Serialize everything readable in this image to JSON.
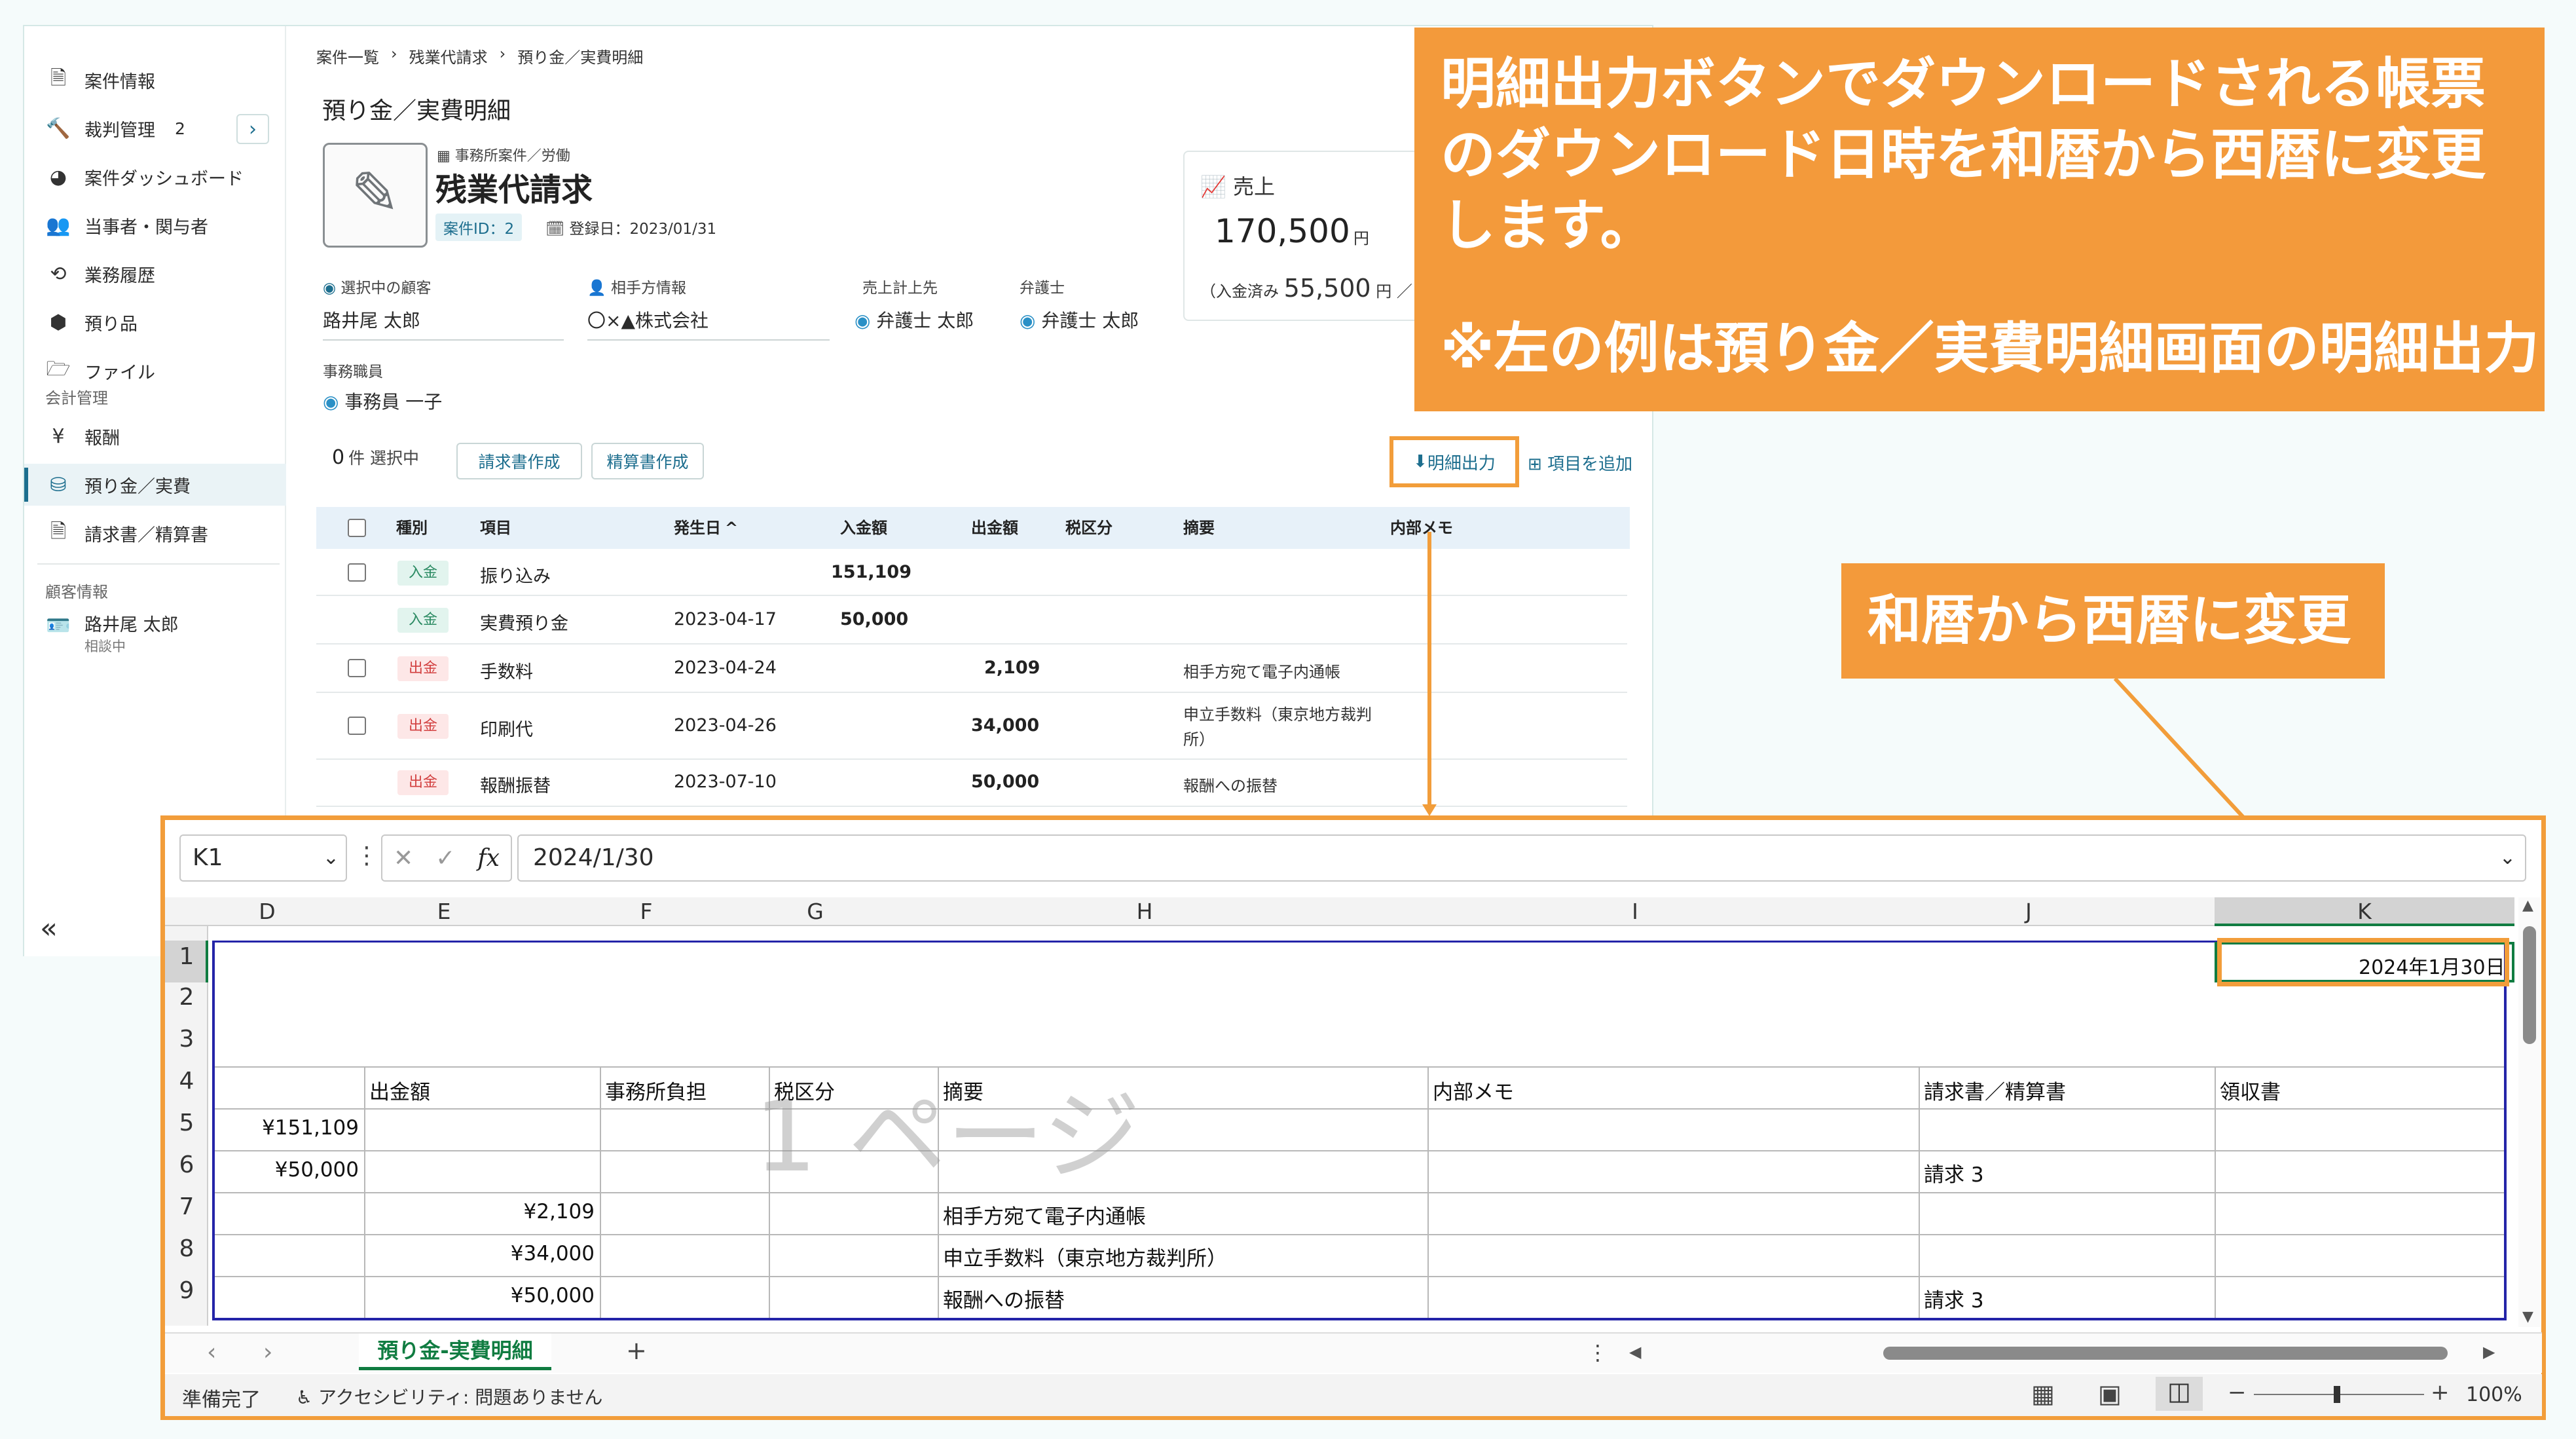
{
  "sidebar": {
    "items": [
      {
        "icon": "document-icon",
        "glyph": "🗎",
        "label": "案件情報"
      },
      {
        "icon": "gavel-icon",
        "glyph": "🔨",
        "label": "裁判管理",
        "count": "2"
      },
      {
        "icon": "dashboard-icon",
        "glyph": "◕",
        "label": "案件ダッシュボード"
      },
      {
        "icon": "people-icon",
        "glyph": "👥",
        "label": "当事者・関与者"
      },
      {
        "icon": "history-icon",
        "glyph": "⟲",
        "label": "業務履歴"
      },
      {
        "icon": "box-icon",
        "glyph": "⬢",
        "label": "預り品"
      },
      {
        "icon": "folder-icon",
        "glyph": "🗁",
        "label": "ファイル"
      }
    ],
    "section_accounting": "会計管理",
    "accounting_items": [
      {
        "icon": "yen-icon",
        "glyph": "¥",
        "label": "報酬"
      },
      {
        "icon": "coins-icon",
        "glyph": "⛁",
        "label": "預り金／実費"
      },
      {
        "icon": "invoice-icon",
        "glyph": "🗎",
        "label": "請求書／精算書"
      }
    ],
    "section_client": "顧客情報",
    "client": {
      "name": "路井尾 太郎",
      "status": "相談中"
    },
    "collapse_glyph": "«"
  },
  "breadcrumb": [
    "案件一覧",
    "残業代請求",
    "預り金／実費明細"
  ],
  "breadcrumb_sep": "›",
  "page_title": "預り金／実費明細",
  "case": {
    "category": "事務所案件／労働",
    "title": "残業代請求",
    "case_id": "案件ID：2",
    "registered": "登録日：2023/01/31"
  },
  "sales": {
    "label": "売上",
    "amount": "170,500",
    "unit": "円",
    "paid_label": "（入金済み",
    "paid_amount": "55,500",
    "paid_unit": "円 ／"
  },
  "parties": {
    "client_label": "選択中の顧客",
    "client_value": "路井尾 太郎",
    "opponent_label": "相手方情報",
    "opponent_value": "〇×▲株式会社",
    "sales_to_label": "売上計上先",
    "sales_to_value": "弁護士 太郎",
    "lawyer_label": "弁護士",
    "lawyer_value": "弁護士 太郎",
    "staff_label": "事務職員",
    "staff_value": "事務員 一子"
  },
  "toolbar": {
    "selected_count": "0",
    "selected_suffix": "件 選択中",
    "invoice_button": "請求書作成",
    "settlement_button": "精算書作成",
    "export_button": "明細出力",
    "add_button": "項目を追加"
  },
  "table": {
    "headers": [
      "種別",
      "項目",
      "発生日",
      "入金額",
      "出金額",
      "税区分",
      "摘要",
      "内部メモ"
    ],
    "sort_glyph": "^",
    "rows": [
      {
        "type": "入金",
        "kind": "in",
        "item": "振り込み",
        "date": "",
        "in_amt": "151,109",
        "out_amt": "",
        "memo": "",
        "checkbox": true
      },
      {
        "type": "入金",
        "kind": "in",
        "item": "実費預り金",
        "date": "2023-04-17",
        "in_amt": "50,000",
        "out_amt": "",
        "memo": "",
        "checkbox": false
      },
      {
        "type": "出金",
        "kind": "out",
        "item": "手数料",
        "date": "2023-04-24",
        "in_amt": "",
        "out_amt": "2,109",
        "memo": "相手方宛て電子内通帳",
        "checkbox": true
      },
      {
        "type": "出金",
        "kind": "out",
        "item": "印刷代",
        "date": "2023-04-26",
        "in_amt": "",
        "out_amt": "34,000",
        "memo": "申立手数料（東京地方裁判所）",
        "checkbox": true
      },
      {
        "type": "出金",
        "kind": "out",
        "item": "報酬振替",
        "date": "2023-07-10",
        "in_amt": "",
        "out_amt": "50,000",
        "memo": "報酬への振替",
        "checkbox": false
      }
    ]
  },
  "callout_main": {
    "text": "明細出力ボタンでダウンロードされる帳票のダウンロード日時を和暦から西暦に変更します。",
    "note": "※左の例は預り金／実費明細画面の明細出力"
  },
  "callout_sub": {
    "text": "和暦から西暦に変更"
  },
  "excel": {
    "name_box": "K1",
    "formula": "2024/1/30",
    "fx": "fx",
    "columns": [
      "D",
      "E",
      "F",
      "G",
      "H",
      "I",
      "J",
      "K"
    ],
    "rows": [
      "1",
      "2",
      "3",
      "4",
      "5",
      "6",
      "7",
      "8",
      "9"
    ],
    "k1_value": "2024年1月30日",
    "headers": [
      "出金額",
      "事務所負担",
      "税区分",
      "摘要",
      "内部メモ",
      "請求書／精算書",
      "領収書"
    ],
    "watermark": "1 ページ",
    "cells": {
      "d5": "¥151,109",
      "d6": "¥50,000",
      "e7": "¥2,109",
      "e8": "¥34,000",
      "e9": "¥50,000",
      "h7": "相手方宛て電子内通帳",
      "h8": "申立手数料（東京地方裁判所）",
      "h9": "報酬への振替",
      "j6": "請求 3",
      "j9": "請求 3"
    },
    "sheet_tab": "預り金-実費明細",
    "add_sheet": "+",
    "status": "準備完了",
    "accessibility": "アクセシビリティ: 問題ありません",
    "zoom": "100%"
  },
  "colors": {
    "accent": "#f39a3b",
    "link": "#1d6e8e",
    "excel_green": "#107c41",
    "selection": "#2424a8"
  }
}
